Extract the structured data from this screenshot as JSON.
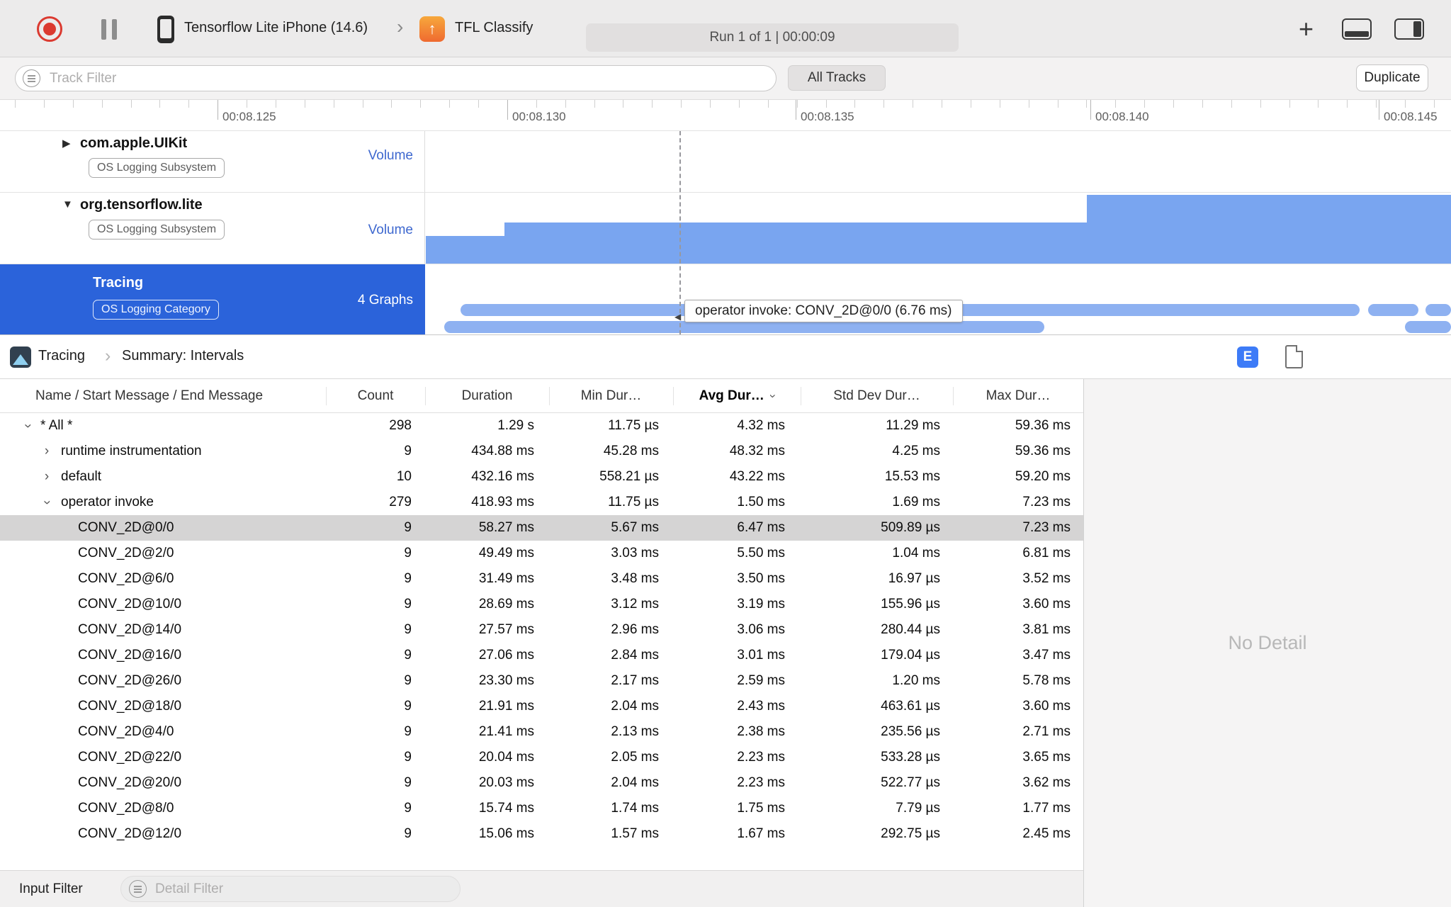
{
  "toolbar": {
    "device_name": "Tensorflow Lite iPhone (14.6)",
    "process_name": "TFL Classify",
    "run_status": "Run 1 of 1   |   00:00:09"
  },
  "filter_bar": {
    "track_filter_placeholder": "Track Filter",
    "all_tracks": "All Tracks",
    "duplicate": "Duplicate"
  },
  "ruler": {
    "labels": [
      "00:08.125",
      "00:08.130",
      "00:08.135",
      "00:08.140",
      "00:08.145"
    ]
  },
  "tracks": [
    {
      "name": "com.apple.UIKit",
      "badge": "OS Logging Subsystem",
      "meta": "Volume",
      "disclosure": "collapsed",
      "selected": false
    },
    {
      "name": "org.tensorflow.lite",
      "badge": "OS Logging Subsystem",
      "meta": "Volume",
      "disclosure": "expanded",
      "selected": false
    },
    {
      "name": "Tracing",
      "badge": "OS Logging Category",
      "meta": "4 Graphs",
      "disclosure": "none",
      "selected": true
    }
  ],
  "track_graphs": {
    "volume_segments": [
      {
        "x0": 0.0,
        "x1": 0.077,
        "h": 0.39
      },
      {
        "x0": 0.077,
        "x1": 0.645,
        "h": 0.58
      },
      {
        "x0": 0.645,
        "x1": 1.0,
        "h": 0.97
      }
    ],
    "tracing_rows": [
      [
        {
          "x0": 0.034,
          "x1": 0.911
        },
        {
          "x0": 0.919,
          "x1": 0.968
        },
        {
          "x0": 0.975,
          "x1": 1.0
        }
      ],
      [
        {
          "x0": 0.018,
          "x1": 0.603
        },
        {
          "x0": 0.955,
          "x1": 1.0
        }
      ]
    ]
  },
  "tooltip_text": "operator invoke: CONV_2D@0/0 (6.76 ms)",
  "detail_header": {
    "breadcrumb_root": "Tracing",
    "breadcrumb_page": "Summary: Intervals",
    "detail_toggle": "E"
  },
  "table": {
    "columns": [
      "Name / Start Message / End Message",
      "Count",
      "Duration",
      "Min Dur…",
      "Avg Dur…",
      "Std Dev Dur…",
      "Max Dur…"
    ],
    "sort_column": "Avg Dur…",
    "rows": [
      {
        "name": "* All *",
        "level": 1,
        "disclosure": "expanded",
        "count": "298",
        "duration": "1.29 s",
        "min": "11.75 µs",
        "avg": "4.32 ms",
        "std": "11.29 ms",
        "max": "59.36 ms",
        "selected": false
      },
      {
        "name": "runtime instrumentation",
        "level": 2,
        "disclosure": "collapsed",
        "count": "9",
        "duration": "434.88 ms",
        "min": "45.28 ms",
        "avg": "48.32 ms",
        "std": "4.25 ms",
        "max": "59.36 ms",
        "selected": false
      },
      {
        "name": "default",
        "level": 2,
        "disclosure": "collapsed",
        "count": "10",
        "duration": "432.16 ms",
        "min": "558.21 µs",
        "avg": "43.22 ms",
        "std": "15.53 ms",
        "max": "59.20 ms",
        "selected": false
      },
      {
        "name": "operator invoke",
        "level": 2,
        "disclosure": "expanded",
        "count": "279",
        "duration": "418.93 ms",
        "min": "11.75 µs",
        "avg": "1.50 ms",
        "std": "1.69 ms",
        "max": "7.23 ms",
        "selected": false
      },
      {
        "name": "CONV_2D@0/0",
        "level": 3,
        "disclosure": null,
        "count": "9",
        "duration": "58.27 ms",
        "min": "5.67 ms",
        "avg": "6.47 ms",
        "std": "509.89 µs",
        "max": "7.23 ms",
        "selected": true
      },
      {
        "name": "CONV_2D@2/0",
        "level": 3,
        "disclosure": null,
        "count": "9",
        "duration": "49.49 ms",
        "min": "3.03 ms",
        "avg": "5.50 ms",
        "std": "1.04 ms",
        "max": "6.81 ms",
        "selected": false
      },
      {
        "name": "CONV_2D@6/0",
        "level": 3,
        "disclosure": null,
        "count": "9",
        "duration": "31.49 ms",
        "min": "3.48 ms",
        "avg": "3.50 ms",
        "std": "16.97 µs",
        "max": "3.52 ms",
        "selected": false
      },
      {
        "name": "CONV_2D@10/0",
        "level": 3,
        "disclosure": null,
        "count": "9",
        "duration": "28.69 ms",
        "min": "3.12 ms",
        "avg": "3.19 ms",
        "std": "155.96 µs",
        "max": "3.60 ms",
        "selected": false
      },
      {
        "name": "CONV_2D@14/0",
        "level": 3,
        "disclosure": null,
        "count": "9",
        "duration": "27.57 ms",
        "min": "2.96 ms",
        "avg": "3.06 ms",
        "std": "280.44 µs",
        "max": "3.81 ms",
        "selected": false
      },
      {
        "name": "CONV_2D@16/0",
        "level": 3,
        "disclosure": null,
        "count": "9",
        "duration": "27.06 ms",
        "min": "2.84 ms",
        "avg": "3.01 ms",
        "std": "179.04 µs",
        "max": "3.47 ms",
        "selected": false
      },
      {
        "name": "CONV_2D@26/0",
        "level": 3,
        "disclosure": null,
        "count": "9",
        "duration": "23.30 ms",
        "min": "2.17 ms",
        "avg": "2.59 ms",
        "std": "1.20 ms",
        "max": "5.78 ms",
        "selected": false
      },
      {
        "name": "CONV_2D@18/0",
        "level": 3,
        "disclosure": null,
        "count": "9",
        "duration": "21.91 ms",
        "min": "2.04 ms",
        "avg": "2.43 ms",
        "std": "463.61 µs",
        "max": "3.60 ms",
        "selected": false
      },
      {
        "name": "CONV_2D@4/0",
        "level": 3,
        "disclosure": null,
        "count": "9",
        "duration": "21.41 ms",
        "min": "2.13 ms",
        "avg": "2.38 ms",
        "std": "235.56 µs",
        "max": "2.71 ms",
        "selected": false
      },
      {
        "name": "CONV_2D@22/0",
        "level": 3,
        "disclosure": null,
        "count": "9",
        "duration": "20.04 ms",
        "min": "2.05 ms",
        "avg": "2.23 ms",
        "std": "533.28 µs",
        "max": "3.65 ms",
        "selected": false
      },
      {
        "name": "CONV_2D@20/0",
        "level": 3,
        "disclosure": null,
        "count": "9",
        "duration": "20.03 ms",
        "min": "2.04 ms",
        "avg": "2.23 ms",
        "std": "522.77 µs",
        "max": "3.62 ms",
        "selected": false
      },
      {
        "name": "CONV_2D@8/0",
        "level": 3,
        "disclosure": null,
        "count": "9",
        "duration": "15.74 ms",
        "min": "1.74 ms",
        "avg": "1.75 ms",
        "std": "7.79 µs",
        "max": "1.77 ms",
        "selected": false
      },
      {
        "name": "CONV_2D@12/0",
        "level": 3,
        "disclosure": null,
        "count": "9",
        "duration": "15.06 ms",
        "min": "1.57 ms",
        "avg": "1.67 ms",
        "std": "292.75 µs",
        "max": "2.45 ms",
        "selected": false
      }
    ]
  },
  "right_panel": {
    "empty_text": "No Detail"
  },
  "bottom_bar": {
    "label": "Input Filter",
    "detail_filter_placeholder": "Detail Filter"
  },
  "icons": {
    "chevron_right": "›",
    "breadcrumb_chevron": "›",
    "disclosure_collapsed": "▶",
    "disclosure_expanded": "▼",
    "app_arrow": "↑",
    "plus": "+",
    "row_chevron": "›",
    "sort_chevron": "›",
    "tooltip_pointer": "◀"
  }
}
